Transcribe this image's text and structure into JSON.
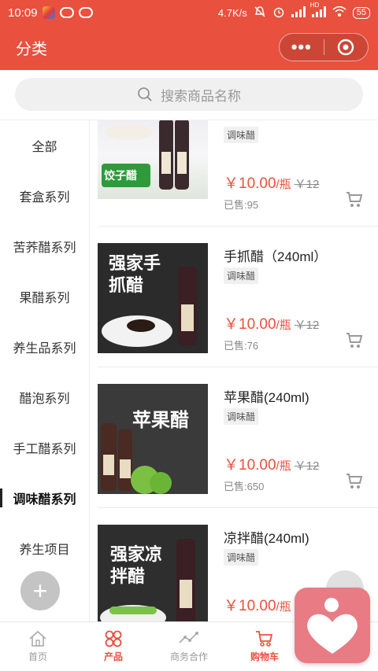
{
  "status_bar": {
    "time": "10:09",
    "speed": "4.7K/s",
    "battery": "55",
    "net_type": "HD"
  },
  "header": {
    "title": "分类",
    "more_glyph": "•••"
  },
  "search": {
    "placeholder": "搜索商品名称"
  },
  "sidebar": {
    "items": [
      {
        "label": "全部"
      },
      {
        "label": "套盒系列"
      },
      {
        "label": "苦荞醋系列"
      },
      {
        "label": "果醋系列"
      },
      {
        "label": "养生品系列"
      },
      {
        "label": "醋泡系列"
      },
      {
        "label": "手工醋系列"
      },
      {
        "label": "调味醋系列"
      },
      {
        "label": "养生项目"
      }
    ],
    "active_index": 7,
    "add_label": "+"
  },
  "products": [
    {
      "name": "",
      "tag": "调味醋",
      "price": "￥10.00",
      "unit": "/瓶",
      "original_price": "￥12",
      "sold": "已售:95",
      "image_text": "饺子醋"
    },
    {
      "name": "手抓醋（240ml）",
      "tag": "调味醋",
      "price": "￥10.00",
      "unit": "/瓶",
      "original_price": "￥12",
      "sold": "已售:76",
      "image_text": "强家手抓醋"
    },
    {
      "name": "苹果醋(240ml)",
      "tag": "调味醋",
      "price": "￥10.00",
      "unit": "/瓶",
      "original_price": "￥12",
      "sold": "已售:650",
      "image_text": "苹果醋"
    },
    {
      "name": "凉拌醋(240ml)",
      "tag": "调味醋",
      "price": "￥10.00",
      "unit": "/瓶",
      "original_price": "",
      "sold": "",
      "image_text": "强家凉拌醋"
    }
  ],
  "tabbar": {
    "items": [
      {
        "label": "首页",
        "icon": "home-icon"
      },
      {
        "label": "产品",
        "icon": "grid-icon"
      },
      {
        "label": "商务合作",
        "icon": "chart-icon"
      },
      {
        "label": "购物车",
        "icon": "cart-icon"
      }
    ]
  },
  "colors": {
    "brand": "#e9503e",
    "text": "#333333",
    "muted": "#999999"
  }
}
